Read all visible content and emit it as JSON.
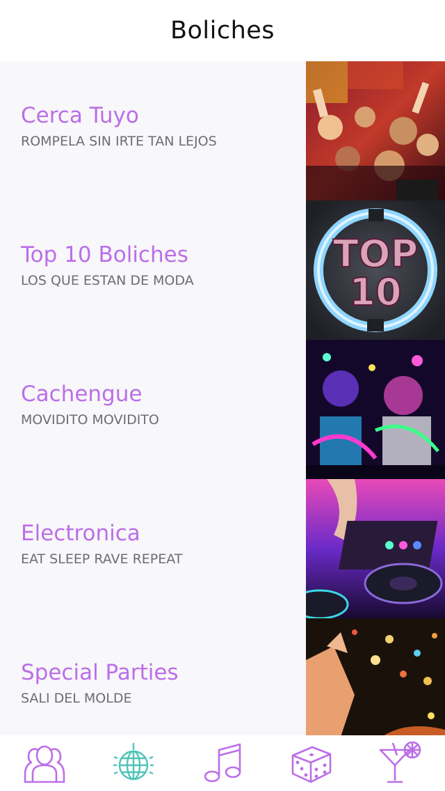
{
  "header": {
    "title": "Boliches"
  },
  "rows": [
    {
      "label": "Cerca Tuyo",
      "subtitle": "ROMPELA SIN IRTE TAN LEJOS",
      "image": "crowd-party-photo"
    },
    {
      "label": "Top 10 Boliches",
      "subtitle": "LOS QUE ESTAN DE MODA",
      "image": "top-10-badge",
      "badge_line1": "TOP",
      "badge_line2": "10"
    },
    {
      "label": "Cachengue",
      "subtitle": "MOVIDITO MOVIDITO",
      "image": "neon-party-photo"
    },
    {
      "label": "Electronica",
      "subtitle": "EAT SLEEP RAVE REPEAT",
      "image": "dj-turntable-photo"
    },
    {
      "label": "Special Parties",
      "subtitle": "SALI DEL MOLDE",
      "image": "confetti-party-photo"
    }
  ],
  "tabbar": {
    "tabs": [
      {
        "icon": "people-icon",
        "active": false
      },
      {
        "icon": "disco-ball-icon",
        "active": true
      },
      {
        "icon": "music-note-icon",
        "active": false
      },
      {
        "icon": "dice-icon",
        "active": false
      },
      {
        "icon": "cocktail-icon",
        "active": false
      }
    ]
  },
  "colors": {
    "accent": "#bb6ee8",
    "active_tab": "#4fc3b8",
    "subtitle": "#6d6d72",
    "background": "#f8f7fa"
  }
}
